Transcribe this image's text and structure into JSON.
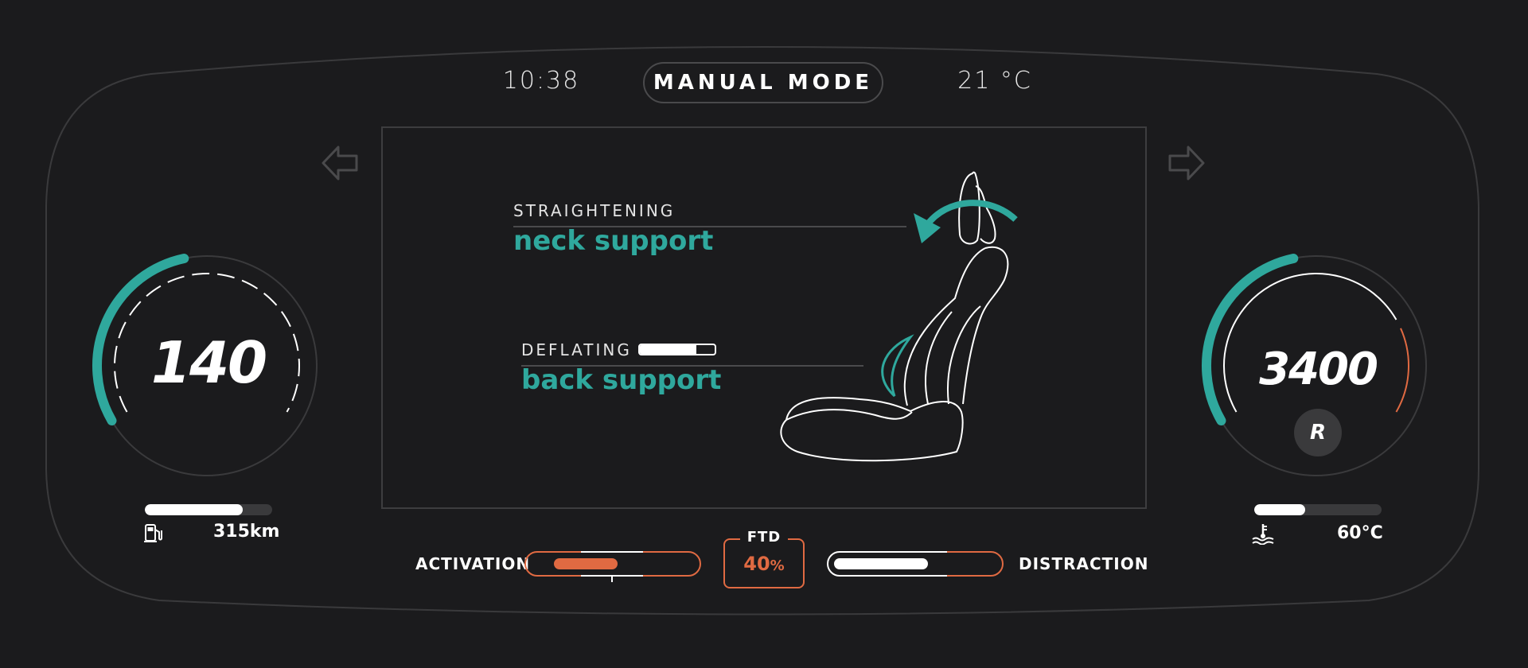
{
  "header": {
    "time": "10:38",
    "mode": "MANUAL MODE",
    "temperature": "21 °C"
  },
  "colors": {
    "accent_teal": "#2fa89d",
    "accent_orange": "#e06a42",
    "background": "#1b1b1d"
  },
  "nav": {
    "left_icon": "arrow-left-icon",
    "right_icon": "arrow-right-icon"
  },
  "seat_panel": {
    "neck": {
      "status": "STRAIGHTENING",
      "part": "neck support"
    },
    "back": {
      "status": "DEFLATING",
      "part": "back support",
      "progress": 0.75
    }
  },
  "speed_gauge": {
    "value": "140",
    "fill_fraction": 0.45
  },
  "rpm_gauge": {
    "value": "3400",
    "gear": "R",
    "fill_fraction": 0.45
  },
  "fuel": {
    "range": "315km",
    "level": 0.77,
    "icon": "fuel-pump-icon"
  },
  "coolant": {
    "temp": "60°C",
    "level": 0.4,
    "icon": "coolant-temp-icon"
  },
  "bottom": {
    "activation_label": "ACTIVATION",
    "distraction_label": "DISTRACTION",
    "ftd_label": "FTD",
    "ftd_value": "40",
    "ftd_unit": "%"
  }
}
